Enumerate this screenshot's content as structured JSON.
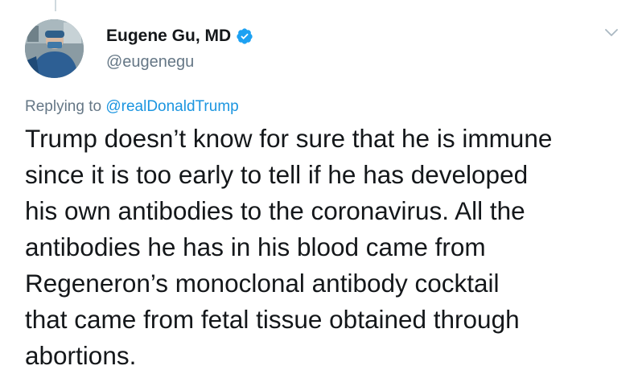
{
  "author": {
    "display_name": "Eugene Gu, MD",
    "handle": "@eugenegu",
    "verified": true,
    "avatar_icon": "profile-photo-surgeon"
  },
  "reply": {
    "prefix": "Replying to",
    "mention": "@realDonaldTrump"
  },
  "tweet": {
    "text": "Trump doesn’t know for sure that he is immune\nsince it is too early to tell if he has developed\nhis own antibodies to the coronavirus. All the\nantibodies he has in his blood came from\nRegeneron’s monoclonal antibody cocktail\nthat came from fetal tissue obtained through\nabortions."
  },
  "icons": {
    "verified": "verified-badge-icon",
    "menu": "chevron-down-icon"
  },
  "colors": {
    "text_primary": "#14171a",
    "text_secondary": "#657786",
    "link": "#1b95e0",
    "verified": "#1da1f2"
  }
}
